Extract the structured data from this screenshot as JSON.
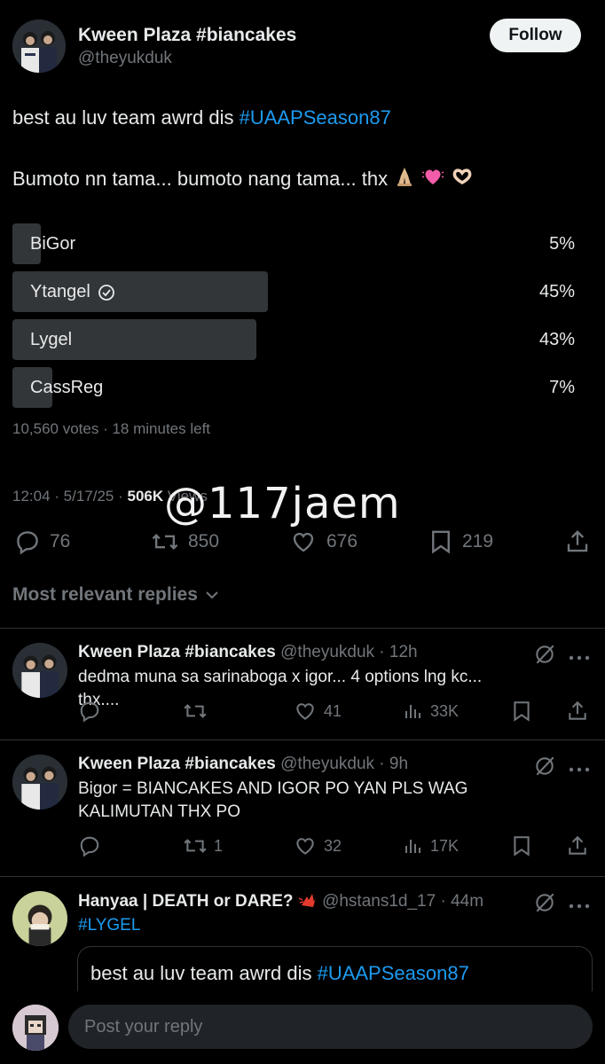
{
  "author": {
    "name": "Kween Plaza #biancakes",
    "handle": "@theyukduk",
    "follow_label": "Follow"
  },
  "tweet": {
    "line1_text": "best au luv team awrd dis ",
    "line1_hashtag": "#UAAPSeason87",
    "line2_text": "Bumoto nn tama... bumoto nang tama... thx"
  },
  "poll": {
    "options": [
      {
        "label": "BiGor",
        "percent": "5%",
        "fraction": 0.05,
        "winner": false
      },
      {
        "label": "Ytangel",
        "percent": "45%",
        "fraction": 0.45,
        "winner": true
      },
      {
        "label": "Lygel",
        "percent": "43%",
        "fraction": 0.43,
        "winner": false
      },
      {
        "label": "CassReg",
        "percent": "7%",
        "fraction": 0.07,
        "winner": false
      }
    ],
    "meta": "10,560 votes · 18 minutes left"
  },
  "timestamp": {
    "time": "12:04 · 5/17/25 · ",
    "views": "506K",
    "views_suffix": " Views"
  },
  "watermark": "@117jaem",
  "actions": {
    "replies": "76",
    "reposts": "850",
    "likes": "676",
    "bookmarks": "219"
  },
  "most_relevant_label": "Most relevant replies",
  "replies": [
    {
      "name": "Kween Plaza #biancakes",
      "handle": "@theyukduk · 12h",
      "text": "dedma muna sa sarinaboga x igor... 4 options lng kc... thx....",
      "reposts": "",
      "likes": "41",
      "views": "33K"
    },
    {
      "name": "Kween Plaza #biancakes",
      "handle": "@theyukduk · 9h",
      "text": "Bigor = BIANCAKES AND IGOR PO YAN PLS WAG KALIMUTAN THX PO",
      "reposts": "1",
      "likes": "32",
      "views": "17K"
    },
    {
      "name": "Hanyaa | DEATH or DARE?",
      "handle": "@hstans1d_17 · 44m",
      "text": "#LYGEL",
      "quote_text": "best au luv team awrd dis ",
      "quote_hashtag": "#UAAPSeason87"
    }
  ],
  "composer": {
    "placeholder": "Post your reply"
  },
  "colors": {
    "background": "#000000",
    "accent": "#1d9bf0",
    "muted": "#71767b",
    "poll_bar": "#333639",
    "text": "#e7e9ea"
  }
}
